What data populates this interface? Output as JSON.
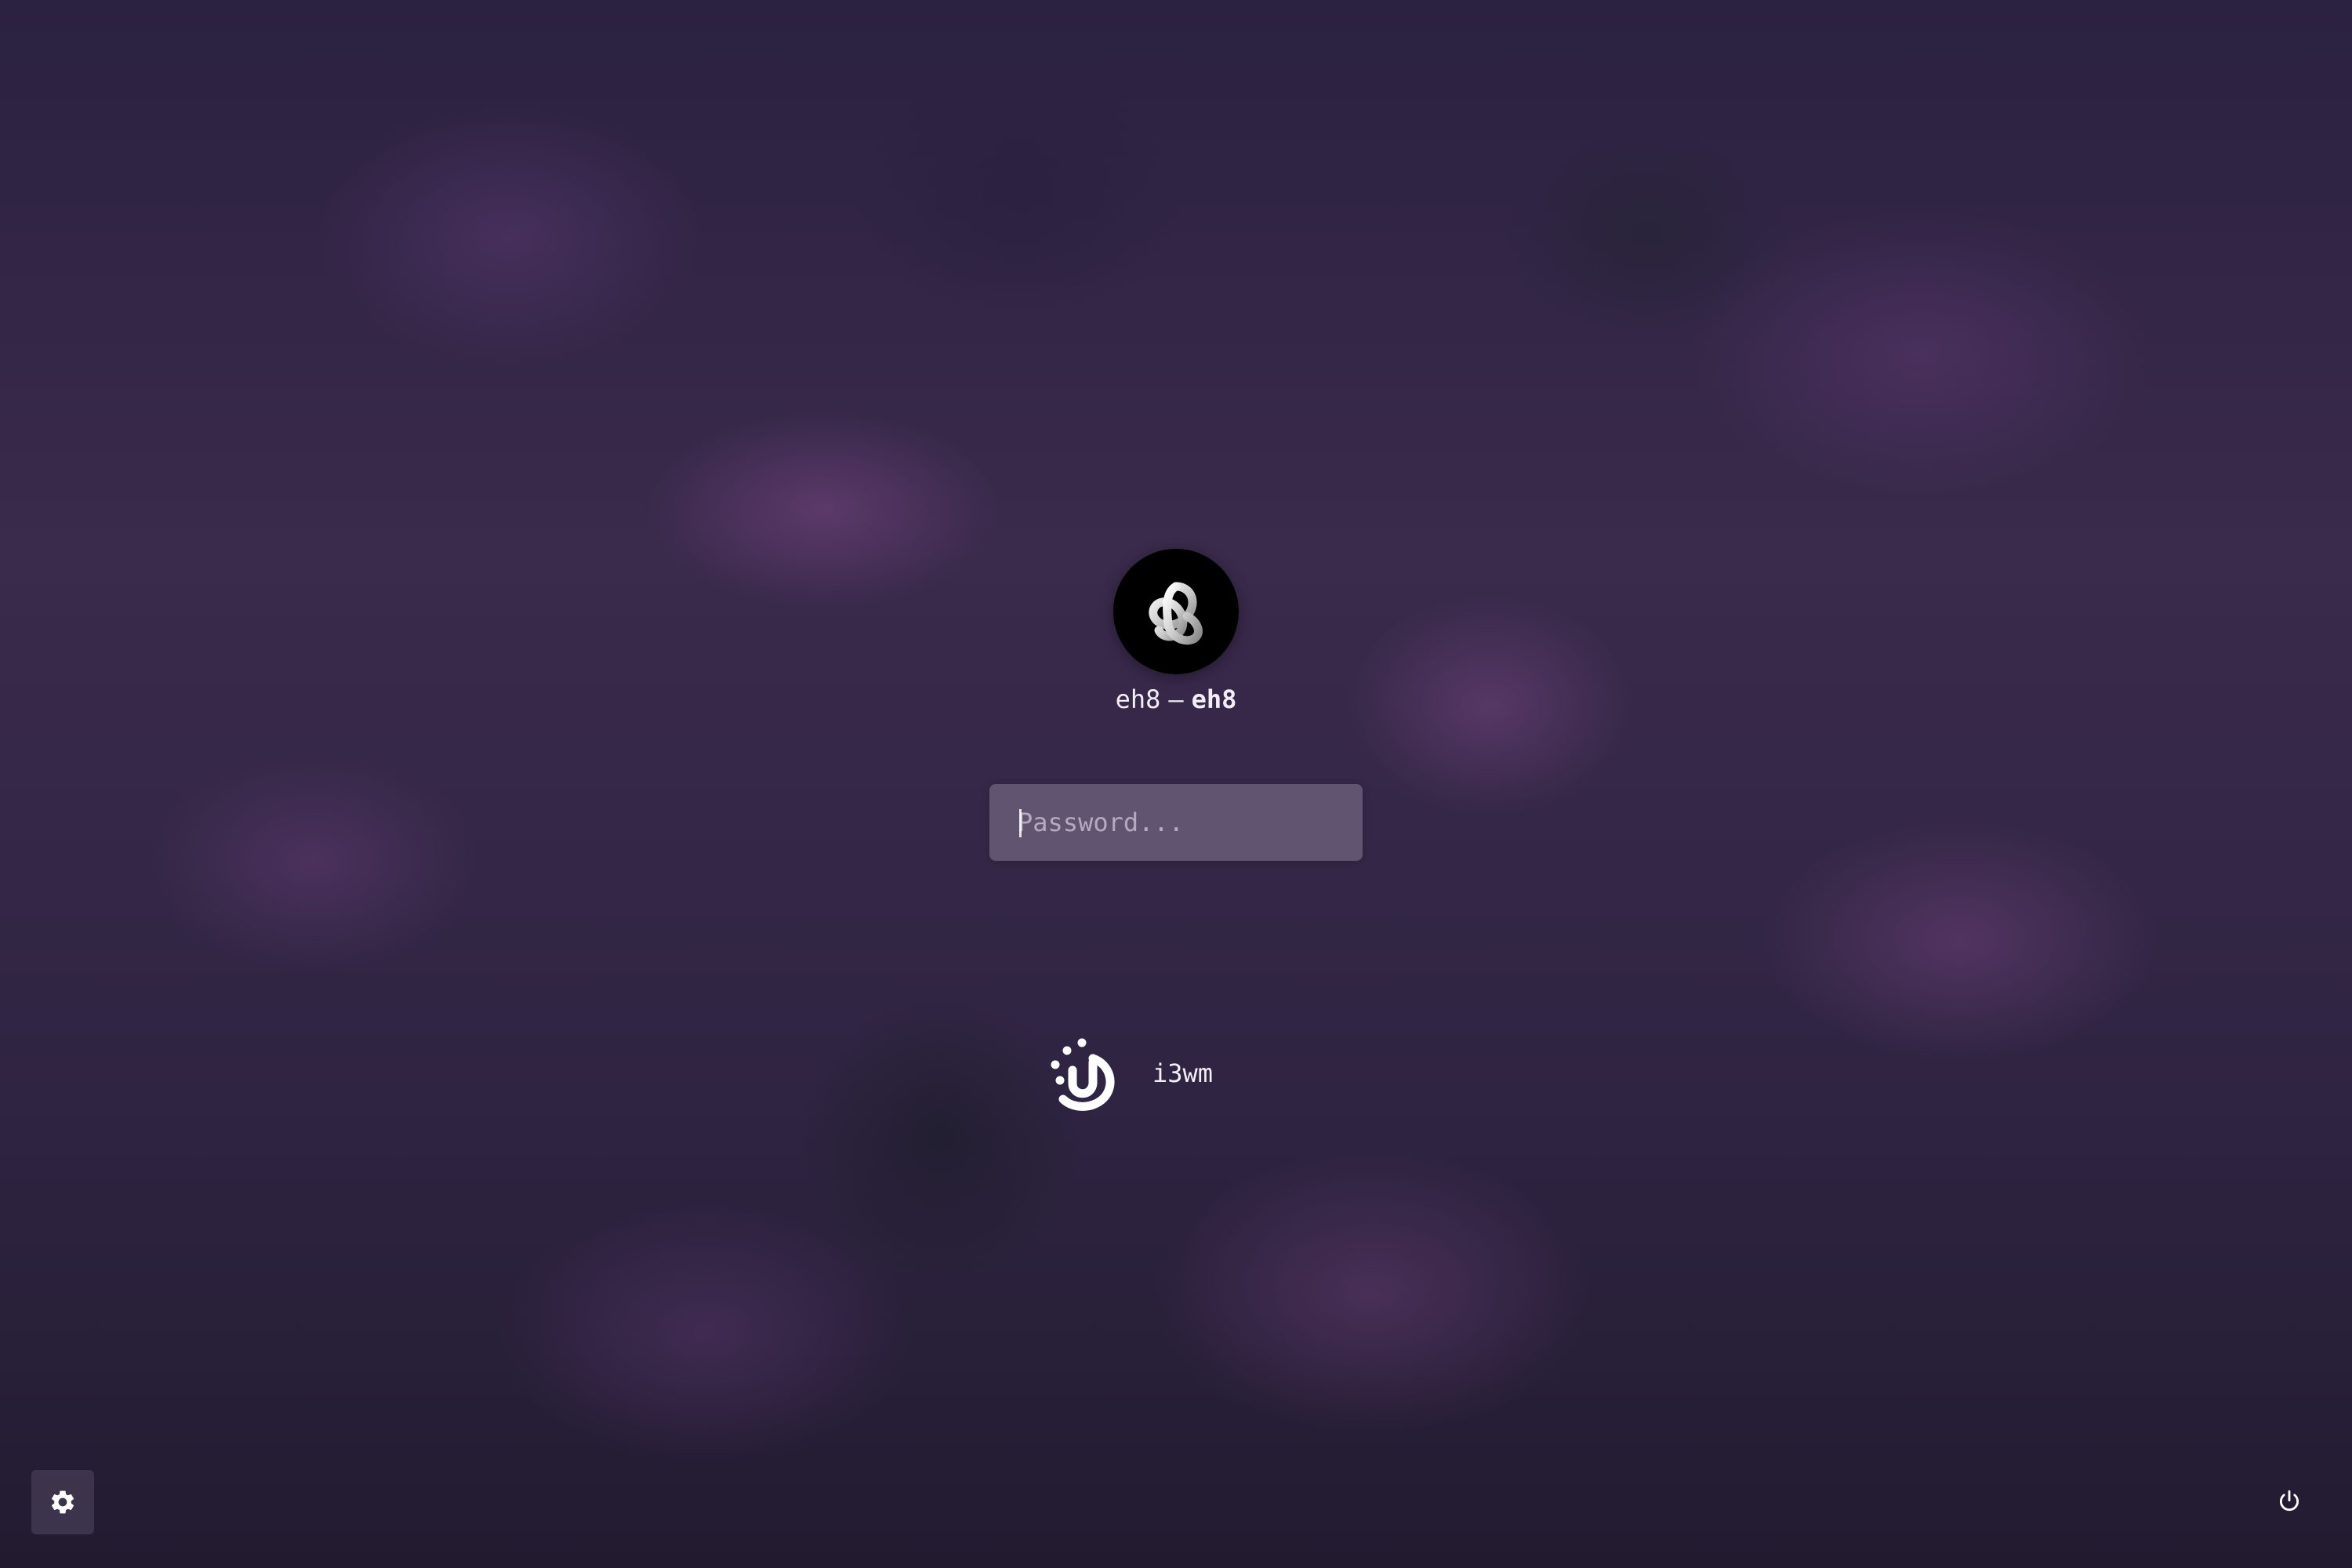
{
  "user": {
    "username": "eh8",
    "separator": "—",
    "hostname": "eh8",
    "avatar_icon": "trefoil-knot-icon"
  },
  "login": {
    "password_placeholder": "Password..."
  },
  "session": {
    "label": "i3wm",
    "icon": "i3wm-logo-icon"
  },
  "controls": {
    "settings_icon": "gear-icon",
    "power_icon": "power-icon"
  },
  "colors": {
    "background": "#2b2140",
    "text": "#ffffff",
    "input_fill": "#8f86a0"
  }
}
